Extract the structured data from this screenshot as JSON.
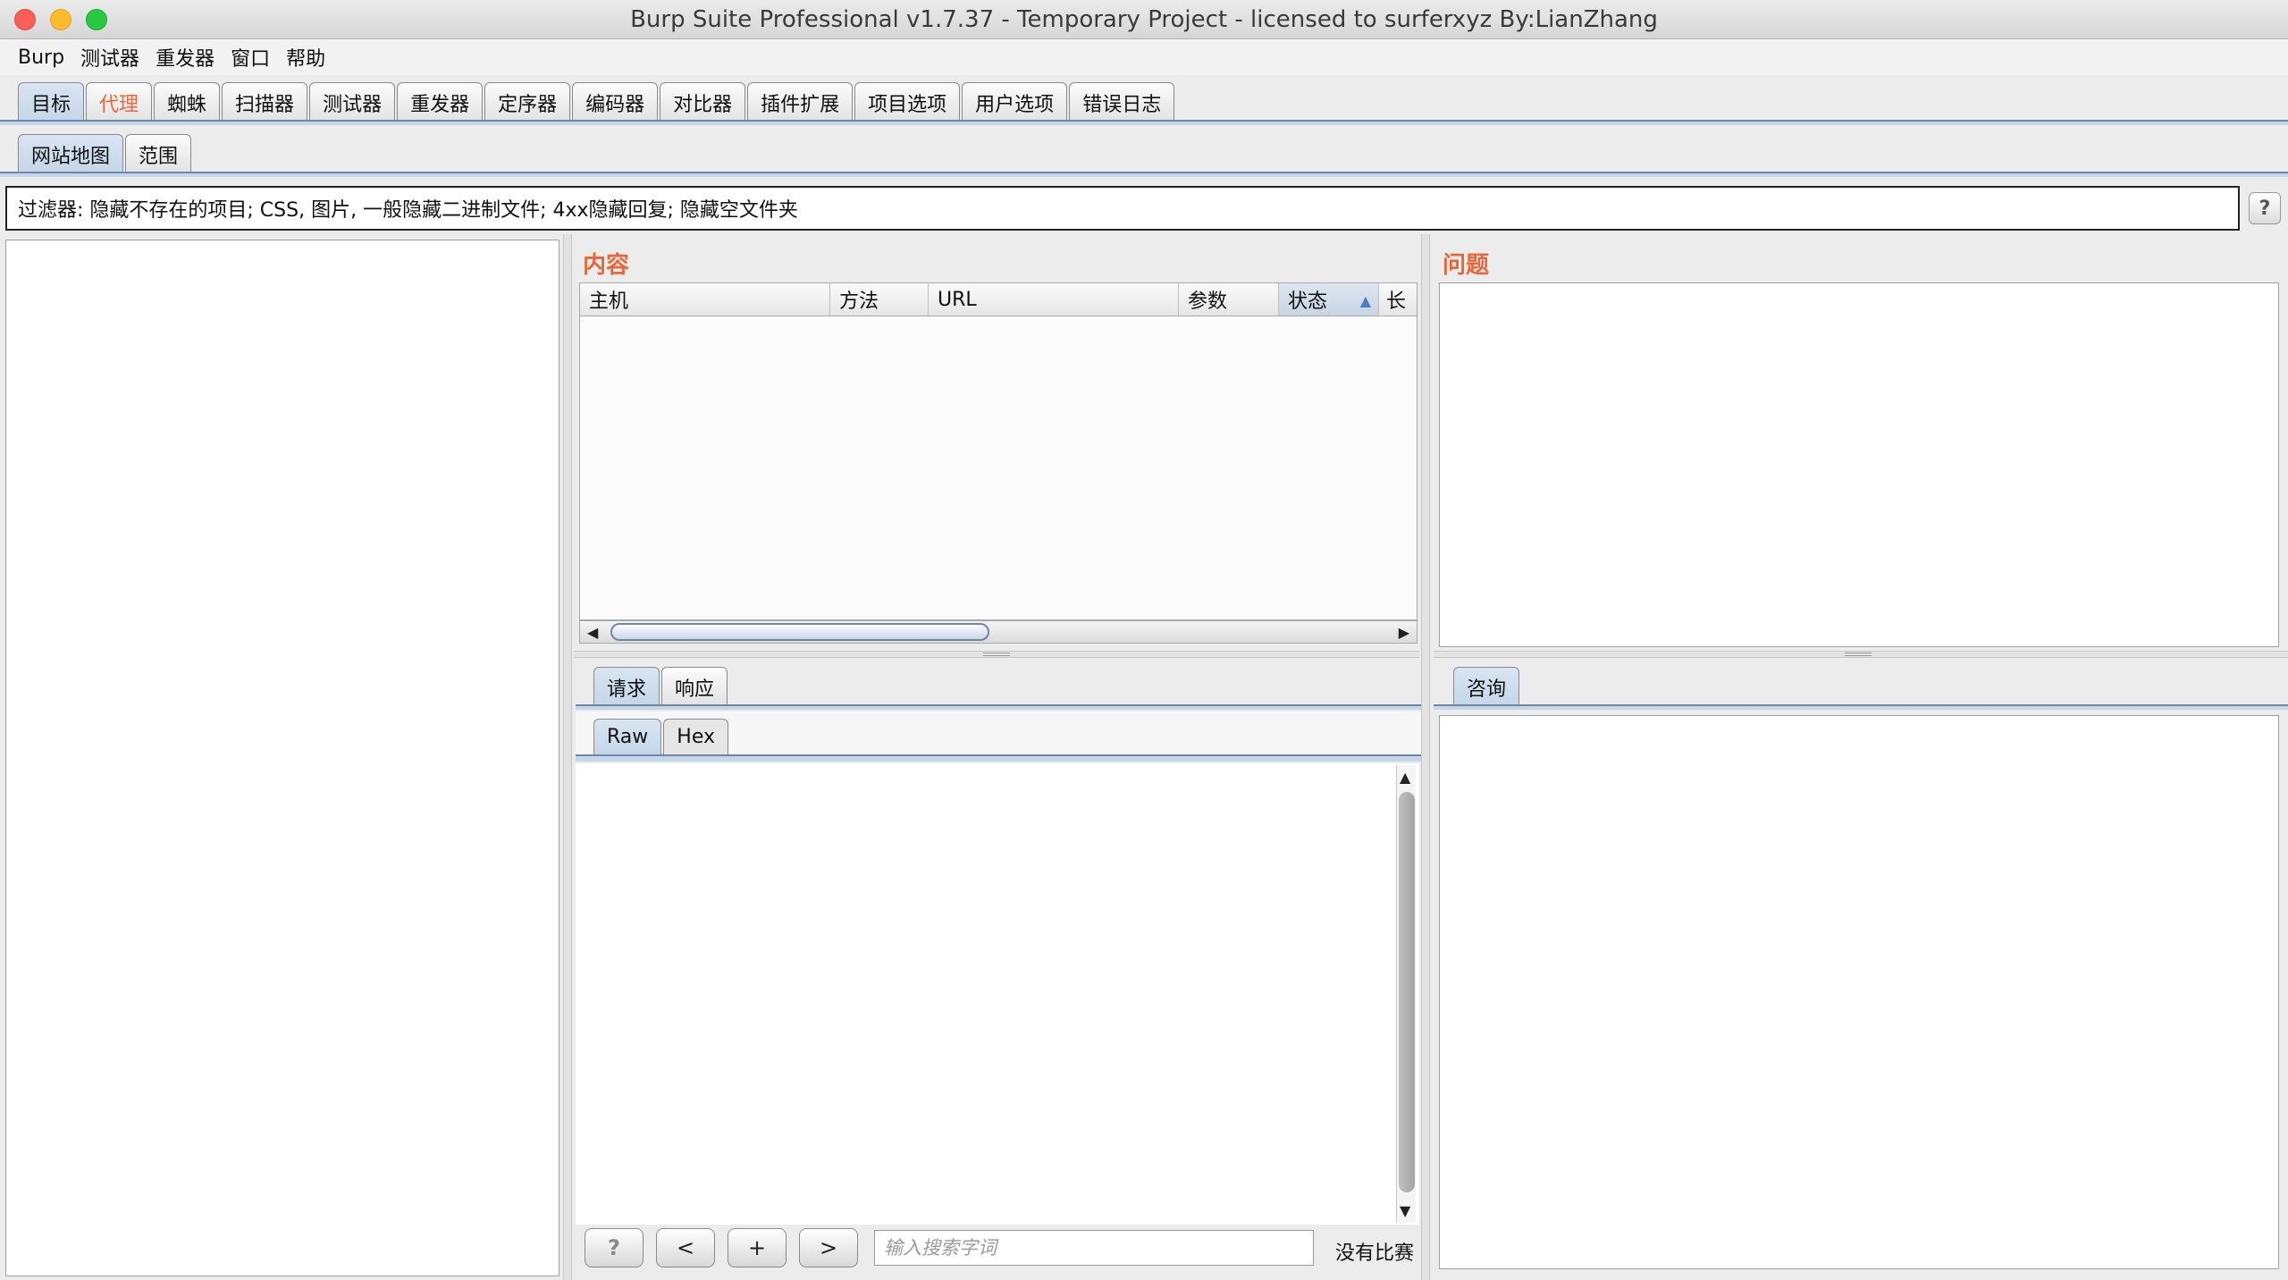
{
  "window": {
    "title": "Burp Suite Professional v1.7.37 - Temporary Project - licensed to surferxyz By:LianZhang"
  },
  "menu": [
    "Burp",
    "测试器",
    "重发器",
    "窗口",
    "帮助"
  ],
  "main_tabs": [
    {
      "label": "目标",
      "state": "selected"
    },
    {
      "label": "代理",
      "state": "highlighted"
    },
    {
      "label": "蜘蛛"
    },
    {
      "label": "扫描器"
    },
    {
      "label": "测试器"
    },
    {
      "label": "重发器"
    },
    {
      "label": "定序器"
    },
    {
      "label": "编码器"
    },
    {
      "label": "对比器"
    },
    {
      "label": "插件扩展"
    },
    {
      "label": "项目选项"
    },
    {
      "label": "用户选项"
    },
    {
      "label": "错误日志"
    }
  ],
  "sub_tabs": [
    {
      "label": "网站地图",
      "state": "selected"
    },
    {
      "label": "范围"
    }
  ],
  "filter": {
    "text": "过滤器: 隐藏不存在的项目; CSS, 图片, 一般隐藏二进制文件; 4xx隐藏回复; 隐藏空文件夹",
    "help_label": "?"
  },
  "contents": {
    "label": "内容",
    "columns": [
      "主机",
      "方法",
      "URL",
      "参数",
      "状态",
      "长"
    ],
    "sorted_column": "状态",
    "sort_icon": "sort-ascending-icon",
    "rows": []
  },
  "issues": {
    "label": "问题"
  },
  "message_tabs": [
    {
      "label": "请求",
      "state": "selected"
    },
    {
      "label": "响应"
    }
  ],
  "view_tabs": [
    {
      "label": "Raw",
      "state": "selected"
    },
    {
      "label": "Hex"
    }
  ],
  "advisory_tab": {
    "label": "咨询"
  },
  "bottom_bar": {
    "help": "?",
    "prev": "<",
    "add": "+",
    "next": ">",
    "search_placeholder": "输入搜索字词",
    "status": "没有比赛"
  },
  "colors": {
    "accent": "#e8673a",
    "selected_tab": "#c5d6e8"
  }
}
